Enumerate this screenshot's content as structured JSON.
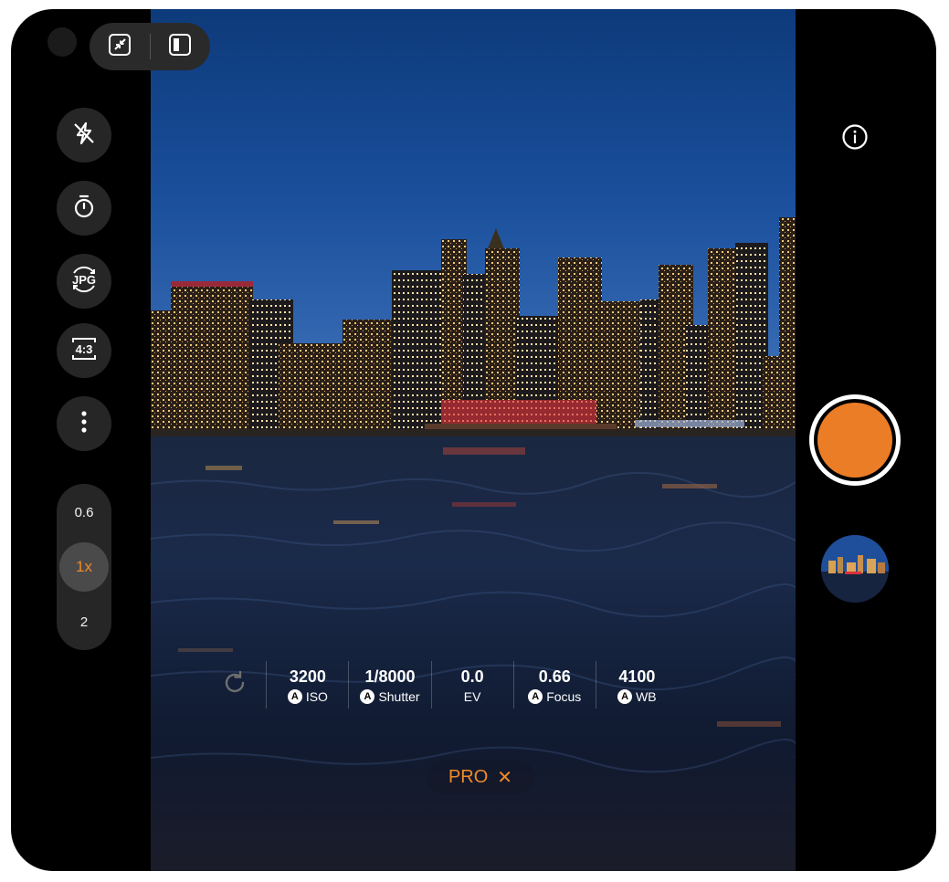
{
  "window_controls": {
    "collapse_icon": "collapse-arrows-icon",
    "split_icon": "split-view-icon"
  },
  "left_rail": {
    "buttons": [
      {
        "name": "flash-off",
        "icon": "flash-off-icon"
      },
      {
        "name": "timer",
        "icon": "timer-icon"
      },
      {
        "name": "format",
        "icon": "jpg-format-icon",
        "label": "JPG"
      },
      {
        "name": "aspect-ratio",
        "icon": "aspect-ratio-icon",
        "label": "4:3"
      },
      {
        "name": "more",
        "icon": "more-vertical-icon"
      }
    ],
    "zoom": {
      "options": [
        "0.6",
        "1x",
        "2"
      ],
      "selected": "1x"
    }
  },
  "right_rail": {
    "info_icon": "info-icon",
    "shutter_color": "#ec7d27",
    "gallery_thumbnail": "last-photo-thumbnail"
  },
  "pro_controls": {
    "reset_icon": "reset-icon",
    "auto_badge": "A",
    "items": [
      {
        "value": "3200",
        "label": "ISO",
        "auto": true
      },
      {
        "value": "1/8000",
        "label": "Shutter",
        "auto": true
      },
      {
        "value": "0.0",
        "label": "EV",
        "auto": false
      },
      {
        "value": "0.66",
        "label": "Focus",
        "auto": true
      },
      {
        "value": "4100",
        "label": "WB",
        "auto": true
      }
    ]
  },
  "mode": {
    "label": "PRO",
    "close_glyph": "✕",
    "accent_color": "#f08a2a"
  }
}
